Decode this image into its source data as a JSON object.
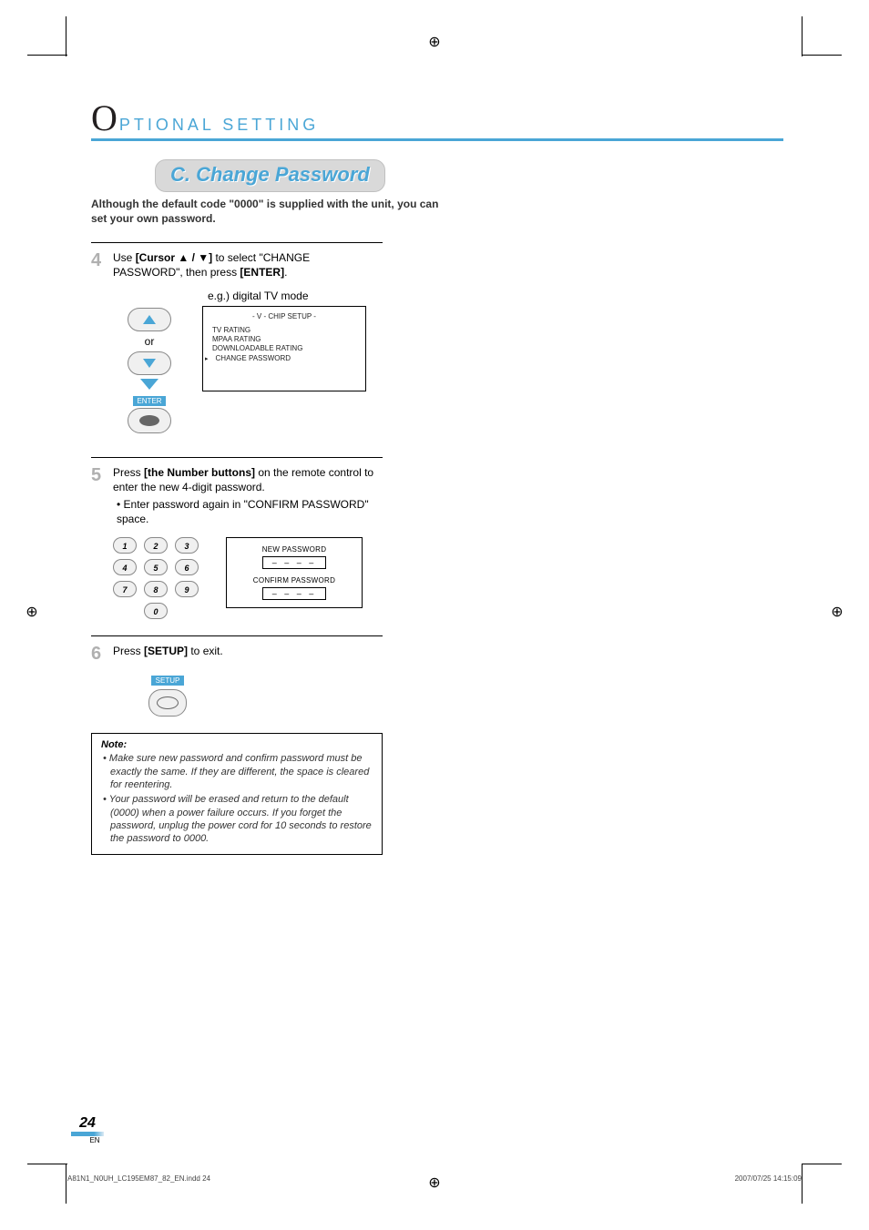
{
  "section": {
    "big_letter": "O",
    "title": "PTIONAL  SETTING"
  },
  "sub_heading": "C.  Change Password",
  "intro": "Although the default code \"0000\" is supplied with the unit, you can set your own password.",
  "step4": {
    "num": "4",
    "pre": "Use ",
    "bold1": "[Cursor ▲ / ▼]",
    "mid": " to select \"CHANGE PASSWORD\", then press ",
    "bold2": "[ENTER]",
    "post": "."
  },
  "caption1": "e.g.) digital TV mode",
  "remote": {
    "or": "or",
    "enter": "ENTER"
  },
  "osd": {
    "title": "-  V - CHIP SETUP -",
    "items": [
      "TV RATING",
      "MPAA RATING",
      "DOWNLOADABLE RATING",
      "CHANGE PASSWORD"
    ],
    "selected_index": 3
  },
  "step5": {
    "num": "5",
    "pre": "Press ",
    "bold1": "[the Number buttons]",
    "post1": " on the remote control to enter the new 4-digit password.",
    "bullet": "• Enter password again in \"CONFIRM PASSWORD\" space."
  },
  "numpad": [
    "1",
    "2",
    "3",
    "4",
    "5",
    "6",
    "7",
    "8",
    "9",
    "0"
  ],
  "pwdbox": {
    "label1": "NEW PASSWORD",
    "val1": "– – – –",
    "label2": "CONFIRM PASSWORD",
    "val2": "– – – –"
  },
  "step6": {
    "num": "6",
    "pre": "Press ",
    "bold1": "[SETUP]",
    "post": " to exit."
  },
  "setup_label": "SETUP",
  "note": {
    "title": "Note:",
    "items": [
      "Make sure new password and confirm password must be exactly the same. If they are different, the space is cleared for reentering.",
      "Your password will be erased and return to the default (0000) when a power failure occurs. If you forget the password, unplug the power cord for 10 seconds to restore the password to 0000."
    ]
  },
  "page_number": "24",
  "page_lang": "EN",
  "footer": {
    "left": "A81N1_N0UH_LC195EM87_82_EN.indd   24",
    "right": "2007/07/25   14:15:09"
  }
}
